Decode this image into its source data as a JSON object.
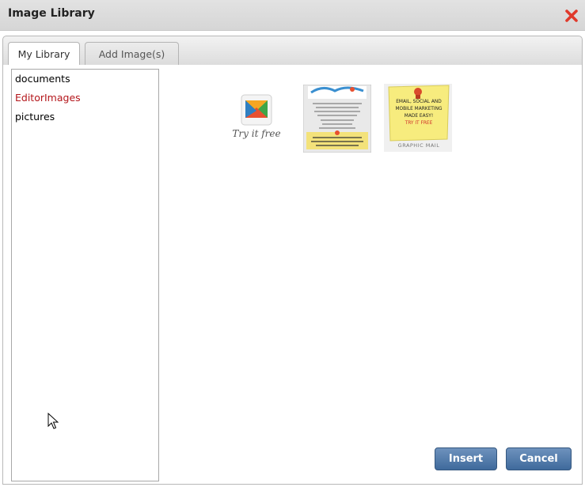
{
  "dialog": {
    "title": "Image Library",
    "close_icon": "close-icon"
  },
  "tabs": [
    {
      "label": "My Library",
      "active": true
    },
    {
      "label": "Add Image(s)",
      "active": false
    }
  ],
  "folders": [
    {
      "label": "documents",
      "selected": false
    },
    {
      "label": "EditorImages",
      "selected": true
    },
    {
      "label": "pictures",
      "selected": false
    }
  ],
  "thumbnails": [
    {
      "name": "envelope-logo",
      "caption": "Try it free"
    },
    {
      "name": "email-promo-flyer",
      "caption": ""
    },
    {
      "name": "sticky-note-ad",
      "note_lines": [
        "EMAIL, SOCIAL AND",
        "MOBILE MARKETING",
        "MADE EASY!",
        "TRY IT FREE"
      ],
      "footer": "GRAPHIC MAIL"
    }
  ],
  "buttons": {
    "insert": "Insert",
    "cancel": "Cancel"
  },
  "colors": {
    "selected_folder": "#b4161b",
    "button_blue": "#4f78a8",
    "close_red": "#e0392b"
  }
}
